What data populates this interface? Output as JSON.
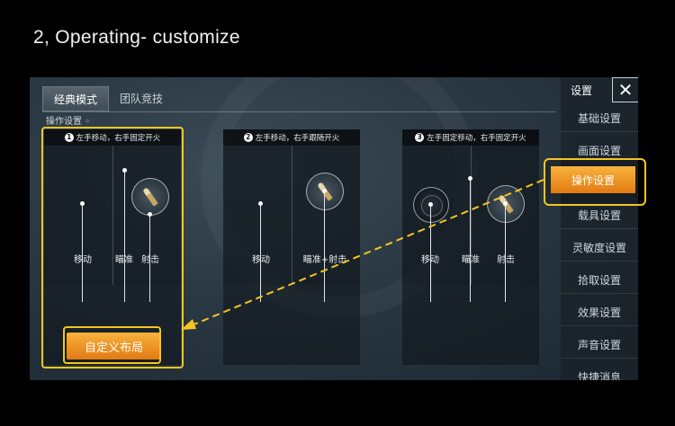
{
  "page_title": "2, Operating- customize",
  "tabs": [
    {
      "label": "经典模式",
      "active": true
    },
    {
      "label": "团队竞技",
      "active": false
    }
  ],
  "section_label": "操作设置",
  "panels": [
    {
      "number": "1",
      "header": "左手移动，右手固定开火",
      "labels": [
        "移动",
        "瞄准",
        "射击"
      ]
    },
    {
      "number": "2",
      "header": "左手移动，右手跟随开火",
      "labels": [
        "移动",
        "瞄准+射击"
      ]
    },
    {
      "number": "3",
      "header": "左手固定移动，右手固定开火",
      "labels": [
        "移动",
        "瞄准",
        "射击"
      ]
    }
  ],
  "custom_layout_button": "自定义布局",
  "sidebar": {
    "title": "设置",
    "close_icon": "close-icon",
    "items": [
      "基础设置",
      "画面设置",
      "操作设置",
      "载具设置",
      "灵敏度设置",
      "拾取设置",
      "效果设置",
      "声音设置",
      "快捷消息"
    ],
    "active_index": 2
  },
  "colors": {
    "highlight": "#f4c522",
    "button_orange": "#e9891a",
    "background": "#000000"
  }
}
